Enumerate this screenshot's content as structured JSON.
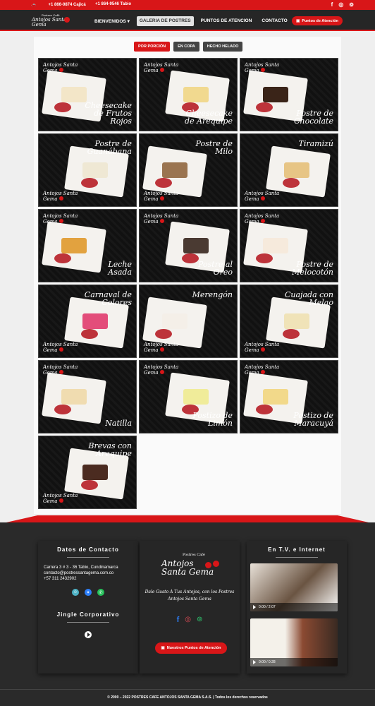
{
  "topbar": {
    "phone1": "+1 866-0874 Cajicá",
    "phone2": "+1 864-9546 Tabio",
    "social_icons": [
      "facebook-icon",
      "instagram-icon",
      "tripadvisor-icon"
    ]
  },
  "nav": {
    "logo": {
      "small": "Postres Café",
      "main": "Antojos Santa Gema"
    },
    "items": [
      {
        "label": "BIENVENIDOS ▾",
        "active": false
      },
      {
        "label": "GALERIA DE POSTRES",
        "active": true
      },
      {
        "label": "PUNTOS DE ATENCION",
        "active": false
      },
      {
        "label": "CONTACTO",
        "active": false
      }
    ],
    "cta": "Puntos de Atención"
  },
  "filters": [
    {
      "label": "POR PORCIÓN",
      "active": true
    },
    {
      "label": "EN COPA",
      "active": false
    },
    {
      "label": "HECHO HELADO",
      "active": false
    }
  ],
  "gallery": [
    {
      "title": "Cheesecake de Frutos Rojos",
      "cake": "#f3e6c8"
    },
    {
      "title": "Cheesecake de Arequipe",
      "cake": "#f1d98f"
    },
    {
      "title": "Postre de Chocolate",
      "cake": "#3a2418"
    },
    {
      "title": "Postre de Guanábana",
      "cake": "#efe8d4"
    },
    {
      "title": "Postre de Milo",
      "cake": "#9a7450"
    },
    {
      "title": "Tiramizú",
      "cake": "#e7c585"
    },
    {
      "title": "Leche Asada",
      "cake": "#e2a23f"
    },
    {
      "title": "Postre al Oreo",
      "cake": "#4a3a32"
    },
    {
      "title": "Postre de Melocotón",
      "cake": "#f6eadc"
    },
    {
      "title": "Carnaval de Colores",
      "cake": "#e34d7a"
    },
    {
      "title": "Merengón",
      "cake": "#f4efe8"
    },
    {
      "title": "Cuajada con Melao",
      "cake": "#f0e3b8"
    },
    {
      "title": "Natilla",
      "cake": "#f0dcb0"
    },
    {
      "title": "Postizo de Limón",
      "cake": "#f0ec9a"
    },
    {
      "title": "Postizo de Maracuyá",
      "cake": "#f2d98a"
    },
    {
      "title": "Brevas con Arequipe",
      "cake": "#4b2b20"
    }
  ],
  "brand": "Antojos Santa Gema",
  "footer": {
    "contact_title": "Datos de Contacto",
    "address": "Carrera 3 # 3 - 36 Tabio, Cundinamarca",
    "email": "contacto@postressantagema.com.co",
    "phone": "+57 311 2432902",
    "contact_icons": [
      "waze-icon",
      "messenger-icon",
      "whatsapp-icon"
    ],
    "jingle_title": "Jingle Corporativo",
    "tagline": "Dale Gusto A Tus Antojos, con los Postres Antojos Santa Gema",
    "cta": "Nuestros Puntos de Atención",
    "tv_title": "En T.V. e Internet",
    "video1_time": "0:00 / 2:07",
    "video2_time": "0:00 / 0:28",
    "copyright": "© 2000 – 2022 POSTRES CAFE ANTOJOS SANTA GEMA S.A.S. | Todos los derechos reservados"
  }
}
